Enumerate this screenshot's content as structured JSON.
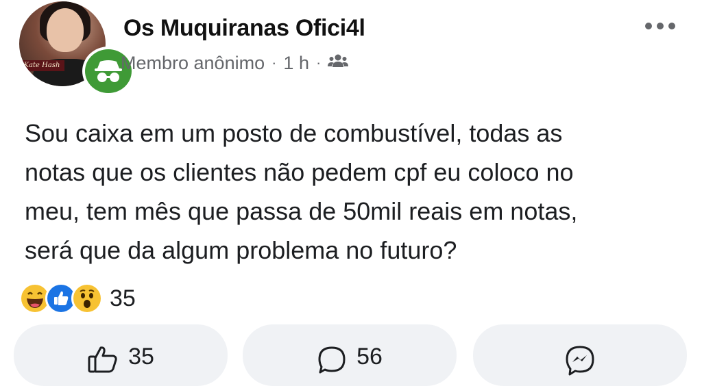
{
  "post": {
    "group_name": "Os Muquiranas Ofici4l",
    "author": "Membro anônimo",
    "time": "1 h",
    "separator": "·",
    "audience_icon": "group-icon",
    "avatar_logo_text": "Kate Hash",
    "body_lines": [
      "Sou caixa em um posto de combustível, todas as",
      "notas que os clientes não pedem cpf eu coloco no",
      "meu, tem mês que passa de 50mil reais em notas,",
      "será que da algum problema no futuro?"
    ]
  },
  "reactions": {
    "icons": [
      "haha-reaction-icon",
      "like-reaction-icon",
      "wow-reaction-icon"
    ],
    "count": "35"
  },
  "actions": {
    "like_count": "35",
    "comment_count": "56"
  },
  "colors": {
    "anonymous_badge": "#3f9a36",
    "like_blue": "#1b74e4",
    "emoji_yellow": "#f7c233",
    "muted_text": "#65676b",
    "action_bg": "#f0f2f5"
  }
}
